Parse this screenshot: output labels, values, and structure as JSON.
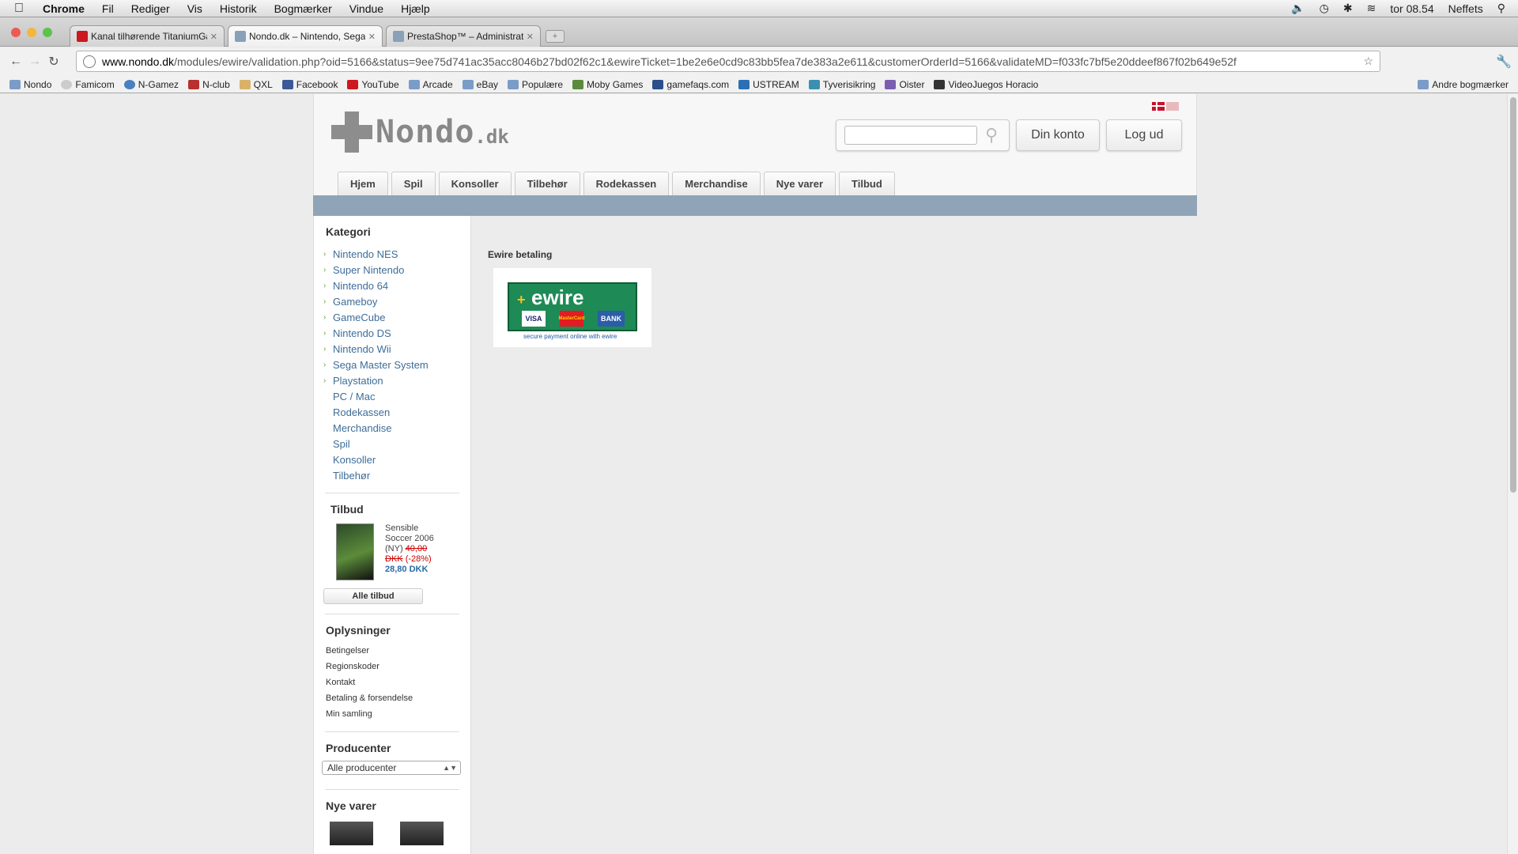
{
  "menubar": {
    "items": [
      "Chrome",
      "Fil",
      "Rediger",
      "Vis",
      "Historik",
      "Bogmærker",
      "Vindue",
      "Hjælp"
    ],
    "clock": "tor 08.54",
    "user": "Neffets"
  },
  "tabs": [
    {
      "title": "Kanal tilhørende TitaniumGa",
      "favicon_color": "#cc181e"
    },
    {
      "title": "Nondo.dk – Nintendo, Sega,",
      "favicon_color": "#8aa0b8"
    },
    {
      "title": "PrestaShop™ – Administratio",
      "favicon_color": "#8aa0b8"
    }
  ],
  "address": {
    "host": "www.nondo.dk",
    "path": "/modules/ewire/validation.php?oid=5166&status=9ee75d741ac35acc8046b27bd02f62c1&ewireTicket=1be2e6e0cd9c83bb5fea7de383a2e611&customerOrderId=5166&validateMD=f033fc7bf5e20ddeef867f02b649e52f"
  },
  "bookmarks": [
    {
      "label": "Nondo",
      "icon": "folder-icon"
    },
    {
      "label": "Famicom",
      "icon": "globe-icon"
    },
    {
      "label": "N-Gamez",
      "icon": "globe-icon"
    },
    {
      "label": "N-club",
      "icon": "n-icon"
    },
    {
      "label": "QXL",
      "icon": "hand-icon"
    },
    {
      "label": "Facebook",
      "icon": "facebook-icon"
    },
    {
      "label": "YouTube",
      "icon": "youtube-icon"
    },
    {
      "label": "Arcade",
      "icon": "folder-icon"
    },
    {
      "label": "eBay",
      "icon": "folder-icon"
    },
    {
      "label": "Populære",
      "icon": "folder-icon"
    },
    {
      "label": "Moby Games",
      "icon": "grid-icon"
    },
    {
      "label": "gamefaqs.com",
      "icon": "page-icon"
    },
    {
      "label": "USTREAM",
      "icon": "u-icon"
    },
    {
      "label": "Tyverisikring",
      "icon": "shield-icon"
    },
    {
      "label": "Oister",
      "icon": "o-icon"
    },
    {
      "label": "VideoJuegos Horacio",
      "icon": "puzzle-icon"
    }
  ],
  "bookmarks_other": "Andre bogmærker",
  "site": {
    "logo_word": "Nondo",
    "logo_tld": ".dk",
    "search_value": "",
    "account_button": "Din konto",
    "logout_button": "Log ud",
    "nav": [
      "Hjem",
      "Spil",
      "Konsoller",
      "Tilbehør",
      "Rodekassen",
      "Merchandise",
      "Nye varer",
      "Tilbud"
    ],
    "category_title": "Kategori",
    "categories": [
      {
        "label": "Nintendo NES",
        "arrow": true
      },
      {
        "label": "Super Nintendo",
        "arrow": true
      },
      {
        "label": "Nintendo 64",
        "arrow": true
      },
      {
        "label": "Gameboy",
        "arrow": true
      },
      {
        "label": "GameCube",
        "arrow": true
      },
      {
        "label": "Nintendo DS",
        "arrow": true
      },
      {
        "label": "Nintendo Wii",
        "arrow": true
      },
      {
        "label": "Sega Master System",
        "arrow": true
      },
      {
        "label": "Playstation",
        "arrow": true
      },
      {
        "label": "PC / Mac",
        "arrow": false
      },
      {
        "label": "Rodekassen",
        "arrow": false
      },
      {
        "label": "Merchandise",
        "arrow": false
      },
      {
        "label": "Spil",
        "arrow": false
      },
      {
        "label": "Konsoller",
        "arrow": false
      },
      {
        "label": "Tilbehør",
        "arrow": false
      }
    ],
    "offer_title": "Tilbud",
    "offer": {
      "name": "Sensible Soccer 2006",
      "condition": "(NY)",
      "old_price": "40,00 DKK",
      "discount": "(-28%)",
      "new_price": "28,80 DKK"
    },
    "all_offers_button": "Alle tilbud",
    "info_title": "Oplysninger",
    "info_links": [
      "Betingelser",
      "Regionskoder",
      "Kontakt",
      "Betaling & forsendelse",
      "Min samling"
    ],
    "producer_title": "Producenter",
    "producer_select": "Alle producenter",
    "new_items_title": "Nye varer",
    "main_title": "Ewire betaling",
    "ewire": {
      "word": "ewire",
      "plus": "+",
      "logos": [
        "VISA",
        "MasterCard",
        "BANK"
      ],
      "tagline": "secure payment online with ewire"
    }
  }
}
